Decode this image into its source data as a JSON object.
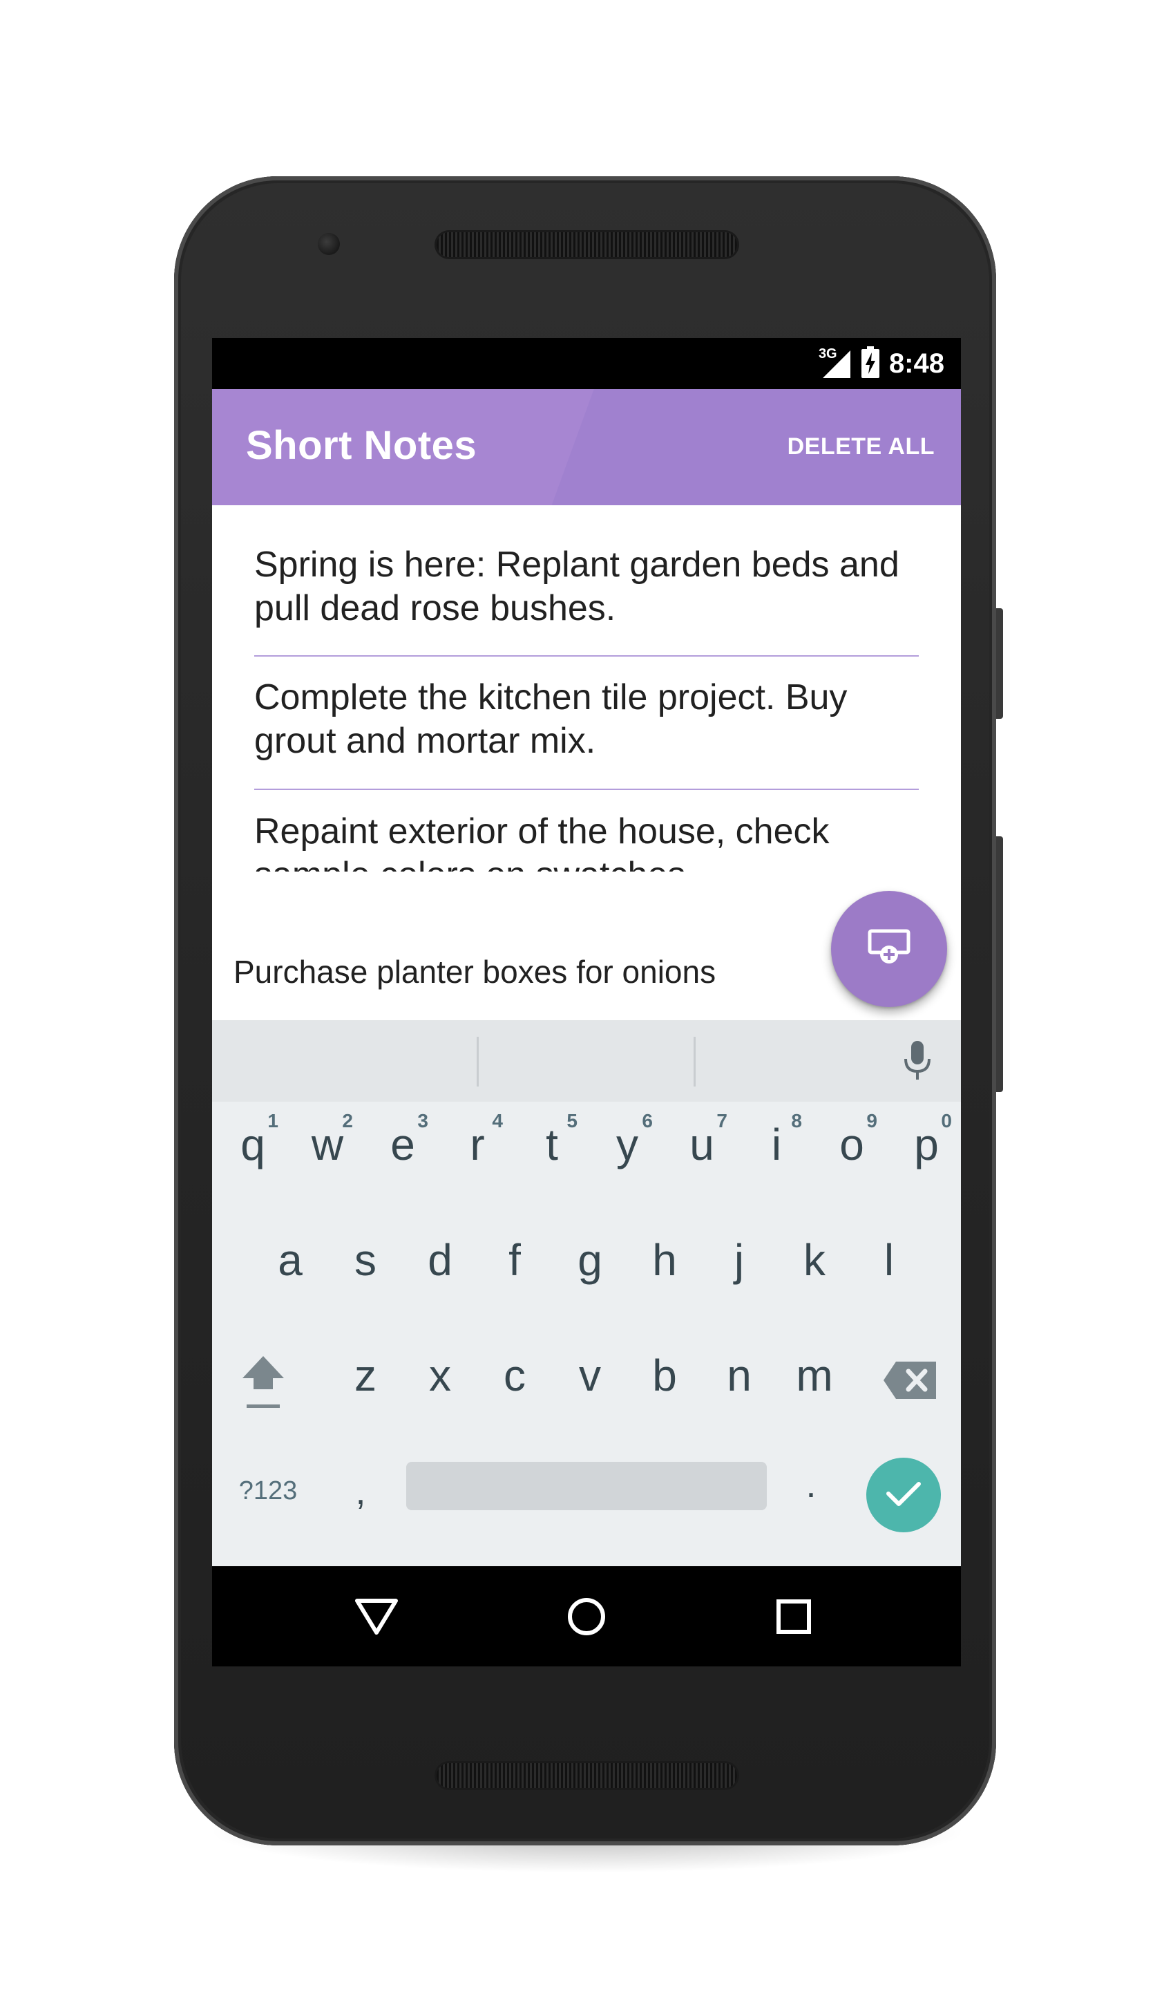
{
  "status_bar": {
    "network_label": "3G",
    "time": "8:48"
  },
  "app_bar": {
    "title": "Short Notes",
    "action_label": "DELETE ALL",
    "color": "#a786d2"
  },
  "notes": [
    {
      "text": "Spring is here: Replant garden beds and pull dead rose bushes."
    },
    {
      "text": "Complete the kitchen tile project. Buy grout and mortar mix."
    },
    {
      "text": "Repaint exterior of the house, check sample colors on swatches."
    }
  ],
  "input": {
    "value": "Purchase planter boxes for onions"
  },
  "fab": {
    "icon": "add-note-icon",
    "color": "#9c7bc7"
  },
  "keyboard": {
    "row1": [
      {
        "key": "q",
        "hint": "1"
      },
      {
        "key": "w",
        "hint": "2"
      },
      {
        "key": "e",
        "hint": "3"
      },
      {
        "key": "r",
        "hint": "4"
      },
      {
        "key": "t",
        "hint": "5"
      },
      {
        "key": "y",
        "hint": "6"
      },
      {
        "key": "u",
        "hint": "7"
      },
      {
        "key": "i",
        "hint": "8"
      },
      {
        "key": "o",
        "hint": "9"
      },
      {
        "key": "p",
        "hint": "0"
      }
    ],
    "row2": [
      "a",
      "s",
      "d",
      "f",
      "g",
      "h",
      "j",
      "k",
      "l"
    ],
    "row3": [
      "z",
      "x",
      "c",
      "v",
      "b",
      "n",
      "m"
    ],
    "symbols_label": "?123",
    "comma": ",",
    "period": ".",
    "mic_icon": "microphone-icon",
    "shift_icon": "shift-icon",
    "backspace_icon": "backspace-icon",
    "enter_icon": "checkmark-icon",
    "enter_color": "#4db6ac"
  },
  "nav_bar": {
    "back_icon": "back-triangle-icon",
    "home_icon": "home-circle-icon",
    "recents_icon": "recents-square-icon"
  }
}
